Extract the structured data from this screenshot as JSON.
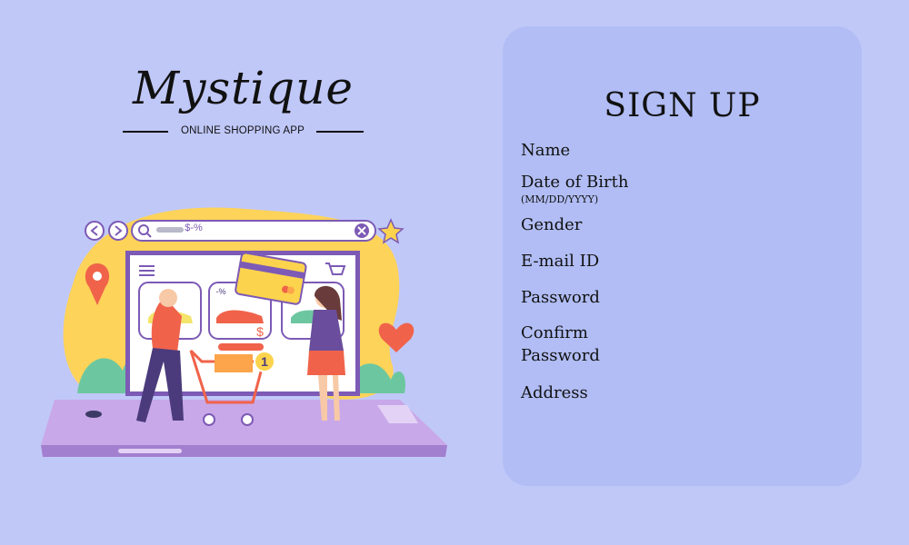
{
  "brand": {
    "name": "Mystique",
    "tagline": "ONLINE SHOPPING APP"
  },
  "illustration": {
    "search_text": "$-%",
    "discount_tag": "-%",
    "price_tag": "$",
    "cart_count": "1"
  },
  "form": {
    "title": "SIGN UP",
    "fields": {
      "name": "Name",
      "dob": "Date of Birth",
      "dob_hint": "(MM/DD/YYYY)",
      "gender": "Gender",
      "email": "E-mail ID",
      "password": "Password",
      "confirm_line1": "Confirm",
      "confirm_line2": "Password",
      "address": "Address"
    }
  },
  "colors": {
    "background": "#c0c8f8",
    "card": "#b1bdf4",
    "accent_red": "#f0634a",
    "accent_purple": "#6a4d9c",
    "accent_yellow": "#fcd34d"
  }
}
